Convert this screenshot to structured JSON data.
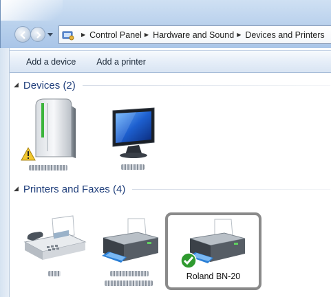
{
  "breadcrumb": {
    "items": [
      "Control Panel",
      "Hardware and Sound",
      "Devices and Printers"
    ]
  },
  "toolbar": {
    "add_device": "Add a device",
    "add_printer": "Add a printer"
  },
  "groups": {
    "devices": {
      "title": "Devices (2)"
    },
    "printers": {
      "title": "Printers and Faxes (4)"
    }
  },
  "printers": {
    "selected": {
      "label": "Roland BN-20",
      "status": "default-printer-check"
    }
  },
  "icons": {
    "computer": "desktop-tower-icon",
    "monitor": "monitor-icon",
    "warning": "warning-icon",
    "fax": "fax-icon",
    "printer": "printer-icon",
    "check": "green-check-icon"
  },
  "colors": {
    "group_title": "#1e3d7a",
    "selection_border": "#8a8a8a",
    "check_green": "#2f9a2f"
  }
}
